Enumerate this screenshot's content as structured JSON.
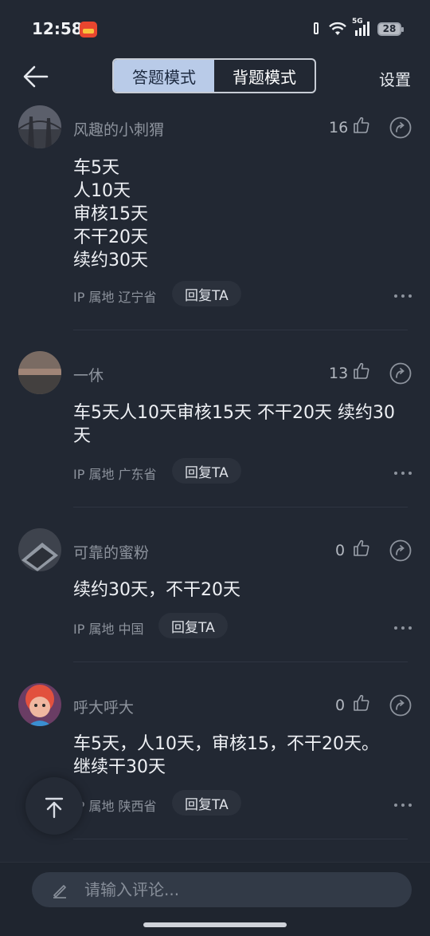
{
  "status_bar": {
    "time": "12:58",
    "network": "5G",
    "battery": "28"
  },
  "header": {
    "modes": [
      "答题模式",
      "背题模式"
    ],
    "active_mode": "答题模式",
    "settings_label": "设置"
  },
  "comments": [
    {
      "username": "风趣的小刺猬",
      "likes": "16",
      "lines": [
        "车5天",
        "人10天",
        "审核15天",
        "不干20天",
        "续约30天"
      ],
      "ip": "IP 属地 辽宁省",
      "reply": "回复TA"
    },
    {
      "username": "一休",
      "likes": "13",
      "lines": [
        "车5天人10天审核15天 不干20天 续约30",
        "天"
      ],
      "ip": "IP 属地 广东省",
      "reply": "回复TA"
    },
    {
      "username": "可靠的蜜粉",
      "likes": "0",
      "lines": [
        "续约30天，不干20天"
      ],
      "ip": "IP 属地 中国",
      "reply": "回复TA"
    },
    {
      "username": "呼大呼大",
      "likes": "0",
      "lines": [
        "车5天，人10天，审核15，不干20天。",
        "继续干30天"
      ],
      "ip": "IP 属地 陕西省",
      "reply": "回复TA"
    }
  ],
  "input": {
    "placeholder": "请输入评论..."
  },
  "colors": {
    "background": "#222833",
    "toggle_active": "#b9cbe8",
    "input_bg": "#323a47"
  }
}
